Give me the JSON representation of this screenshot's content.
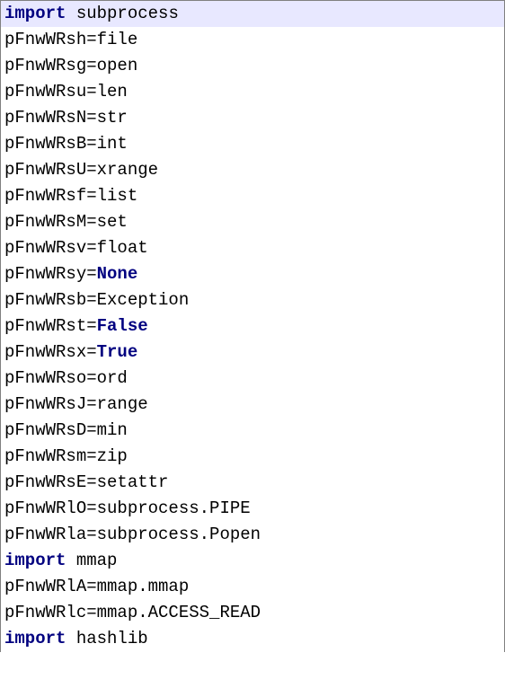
{
  "code": {
    "lines": [
      {
        "name": "code-line-1",
        "highlight": true,
        "tokens": [
          {
            "cls": "tok-kw",
            "text": "import"
          },
          {
            "cls": "tok-plain",
            "text": " subprocess"
          }
        ]
      },
      {
        "name": "code-line-2",
        "tokens": [
          {
            "cls": "tok-plain",
            "text": "pFnwWRsh=file"
          }
        ]
      },
      {
        "name": "code-line-3",
        "tokens": [
          {
            "cls": "tok-plain",
            "text": "pFnwWRsg=open"
          }
        ]
      },
      {
        "name": "code-line-4",
        "tokens": [
          {
            "cls": "tok-plain",
            "text": "pFnwWRsu=len"
          }
        ]
      },
      {
        "name": "code-line-5",
        "tokens": [
          {
            "cls": "tok-plain",
            "text": "pFnwWRsN=str"
          }
        ]
      },
      {
        "name": "code-line-6",
        "tokens": [
          {
            "cls": "tok-plain",
            "text": "pFnwWRsB=int"
          }
        ]
      },
      {
        "name": "code-line-7",
        "tokens": [
          {
            "cls": "tok-plain",
            "text": "pFnwWRsU=xrange"
          }
        ]
      },
      {
        "name": "code-line-8",
        "tokens": [
          {
            "cls": "tok-plain",
            "text": "pFnwWRsf=list"
          }
        ]
      },
      {
        "name": "code-line-9",
        "tokens": [
          {
            "cls": "tok-plain",
            "text": "pFnwWRsM=set"
          }
        ]
      },
      {
        "name": "code-line-10",
        "tokens": [
          {
            "cls": "tok-plain",
            "text": "pFnwWRsv=float"
          }
        ]
      },
      {
        "name": "code-line-11",
        "tokens": [
          {
            "cls": "tok-plain",
            "text": "pFnwWRsy="
          },
          {
            "cls": "tok-const",
            "text": "None"
          }
        ]
      },
      {
        "name": "code-line-12",
        "tokens": [
          {
            "cls": "tok-plain",
            "text": "pFnwWRsb=Exception"
          }
        ]
      },
      {
        "name": "code-line-13",
        "tokens": [
          {
            "cls": "tok-plain",
            "text": "pFnwWRst="
          },
          {
            "cls": "tok-const",
            "text": "False"
          }
        ]
      },
      {
        "name": "code-line-14",
        "tokens": [
          {
            "cls": "tok-plain",
            "text": "pFnwWRsx="
          },
          {
            "cls": "tok-const",
            "text": "True"
          }
        ]
      },
      {
        "name": "code-line-15",
        "tokens": [
          {
            "cls": "tok-plain",
            "text": "pFnwWRso=ord"
          }
        ]
      },
      {
        "name": "code-line-16",
        "tokens": [
          {
            "cls": "tok-plain",
            "text": "pFnwWRsJ=range"
          }
        ]
      },
      {
        "name": "code-line-17",
        "tokens": [
          {
            "cls": "tok-plain",
            "text": "pFnwWRsD=min"
          }
        ]
      },
      {
        "name": "code-line-18",
        "tokens": [
          {
            "cls": "tok-plain",
            "text": "pFnwWRsm=zip"
          }
        ]
      },
      {
        "name": "code-line-19",
        "tokens": [
          {
            "cls": "tok-plain",
            "text": "pFnwWRsE=setattr"
          }
        ]
      },
      {
        "name": "code-line-20",
        "tokens": [
          {
            "cls": "tok-plain",
            "text": "pFnwWRlO=subprocess.PIPE"
          }
        ]
      },
      {
        "name": "code-line-21",
        "tokens": [
          {
            "cls": "tok-plain",
            "text": "pFnwWRla=subprocess.Popen"
          }
        ]
      },
      {
        "name": "code-line-22",
        "tokens": [
          {
            "cls": "tok-kw",
            "text": "import"
          },
          {
            "cls": "tok-plain",
            "text": " mmap"
          }
        ]
      },
      {
        "name": "code-line-23",
        "tokens": [
          {
            "cls": "tok-plain",
            "text": "pFnwWRlA=mmap.mmap"
          }
        ]
      },
      {
        "name": "code-line-24",
        "tokens": [
          {
            "cls": "tok-plain",
            "text": "pFnwWRlc=mmap.ACCESS_READ"
          }
        ]
      },
      {
        "name": "code-line-25",
        "tokens": [
          {
            "cls": "tok-kw",
            "text": "import"
          },
          {
            "cls": "tok-plain",
            "text": " hashlib"
          }
        ]
      }
    ]
  }
}
